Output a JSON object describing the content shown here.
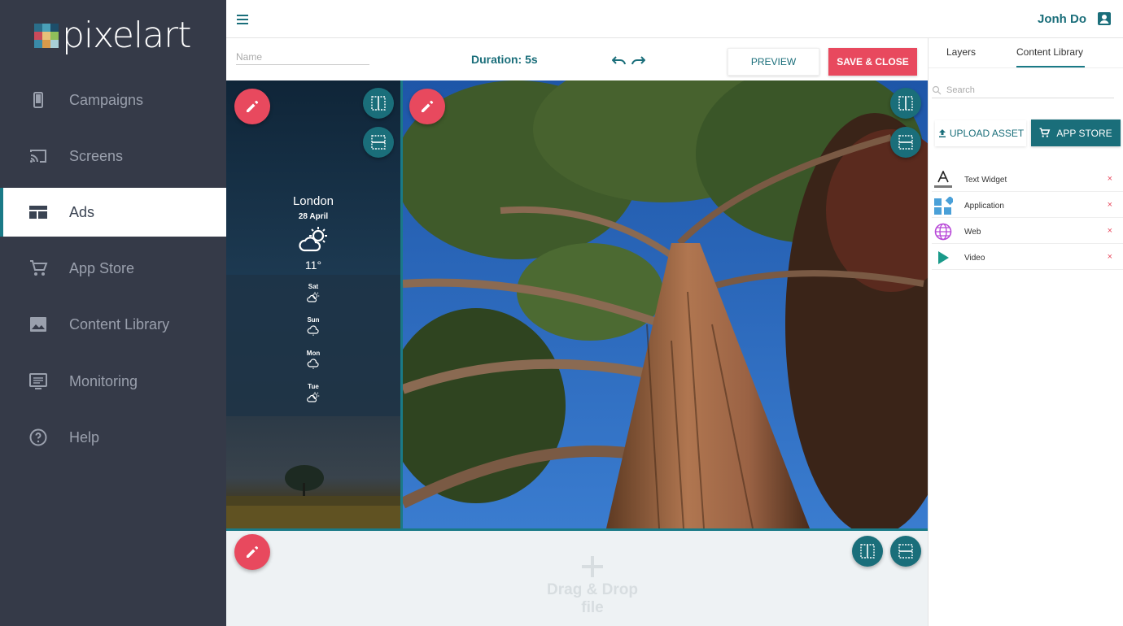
{
  "app": {
    "brand": "pixelart",
    "brand_colors": [
      "#2a6e8a",
      "#4aa0b8",
      "#1d4e6a",
      "#c94a5a",
      "#e6c07a",
      "#8fbf5a",
      "#3a8aa8",
      "#d89a4a",
      "#a8d0d8"
    ]
  },
  "sidebar": {
    "items": [
      {
        "label": "Campaigns",
        "icon": "phone-icon"
      },
      {
        "label": "Screens",
        "icon": "cast-icon"
      },
      {
        "label": "Ads",
        "icon": "dashboard-icon",
        "active": true
      },
      {
        "label": "App Store",
        "icon": "cart-icon"
      },
      {
        "label": "Content Library",
        "icon": "image-icon"
      },
      {
        "label": "Monitoring",
        "icon": "monitor-icon"
      },
      {
        "label": "Help",
        "icon": "help-icon"
      }
    ]
  },
  "header": {
    "user_name": "Jonh Do"
  },
  "toolbar": {
    "name_placeholder": "Name",
    "name_value": "",
    "duration": "Duration: 5s",
    "preview_label": "PREVIEW",
    "save_label": "SAVE & CLOSE"
  },
  "weather": {
    "city": "London",
    "date": "28 April",
    "temp": "11°",
    "forecast": [
      {
        "day": "Sat",
        "icon": "partly-cloudy-icon"
      },
      {
        "day": "Sun",
        "icon": "cloud-drizzle-icon"
      },
      {
        "day": "Mon",
        "icon": "cloud-drizzle-icon"
      },
      {
        "day": "Tue",
        "icon": "partly-cloudy-icon"
      }
    ]
  },
  "dropzone": {
    "label": "Drag & Drop file"
  },
  "panel": {
    "tabs": [
      {
        "label": "Layers"
      },
      {
        "label": "Content Library",
        "active": true
      }
    ],
    "search_placeholder": "Search",
    "upload_label": "UPLOAD ASSET",
    "appstore_label": "APP STORE",
    "items": [
      {
        "label": "Text Widget",
        "icon": "text-icon"
      },
      {
        "label": "Application",
        "icon": "widgets-icon"
      },
      {
        "label": "Web",
        "icon": "globe-icon"
      },
      {
        "label": "Video",
        "icon": "play-icon"
      }
    ],
    "delete_glyph": "×"
  },
  "colors": {
    "accent": "#1a6e7a",
    "danger": "#e8495e",
    "sidebar_bg": "#353a48"
  }
}
